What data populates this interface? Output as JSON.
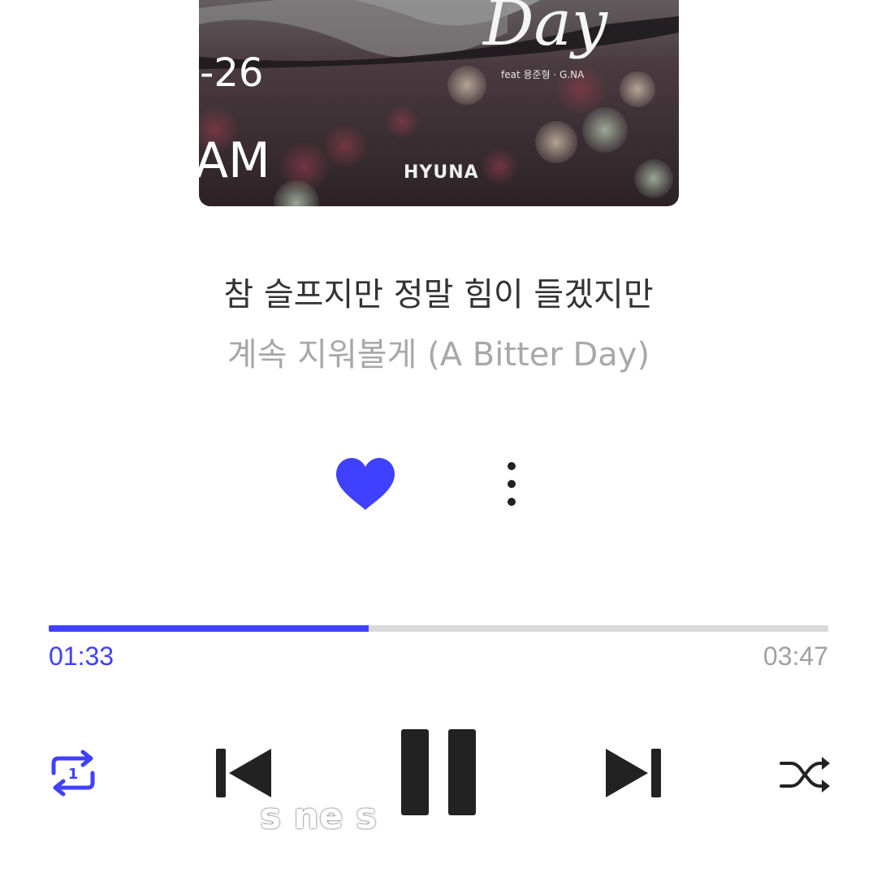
{
  "album_art": {
    "title_script": "Day",
    "feat_text": "feat 용준형 · G.NA",
    "artist_text": "HYUNA",
    "colors": {
      "background": "#3a2f33",
      "mist": "#9a9a9a"
    }
  },
  "lockscreen_overlay": {
    "date_fragment": "-26",
    "time_fragment": "AM"
  },
  "song": {
    "lyric_line": "참 슬프지만 정말 힘이 들겠지만",
    "title": "계속 지워볼게 (A Bitter Day)"
  },
  "actions": {
    "like_icon": "heart-icon",
    "more_icon": "more-vertical-icon",
    "liked": true
  },
  "playback": {
    "current_time": "01:33",
    "total_time": "03:47",
    "progress_fraction": 0.41
  },
  "controls": {
    "repeat_icon": "repeat-one-icon",
    "prev_icon": "skip-previous-icon",
    "pause_icon": "pause-icon",
    "next_icon": "skip-next-icon",
    "shuffle_icon": "shuffle-icon"
  },
  "caption_fragment": "s      ne s",
  "colors": {
    "accent": "#4040ff",
    "primary_text": "#333333",
    "secondary_text": "#a8a8a8",
    "track": "#d9d9d9"
  }
}
